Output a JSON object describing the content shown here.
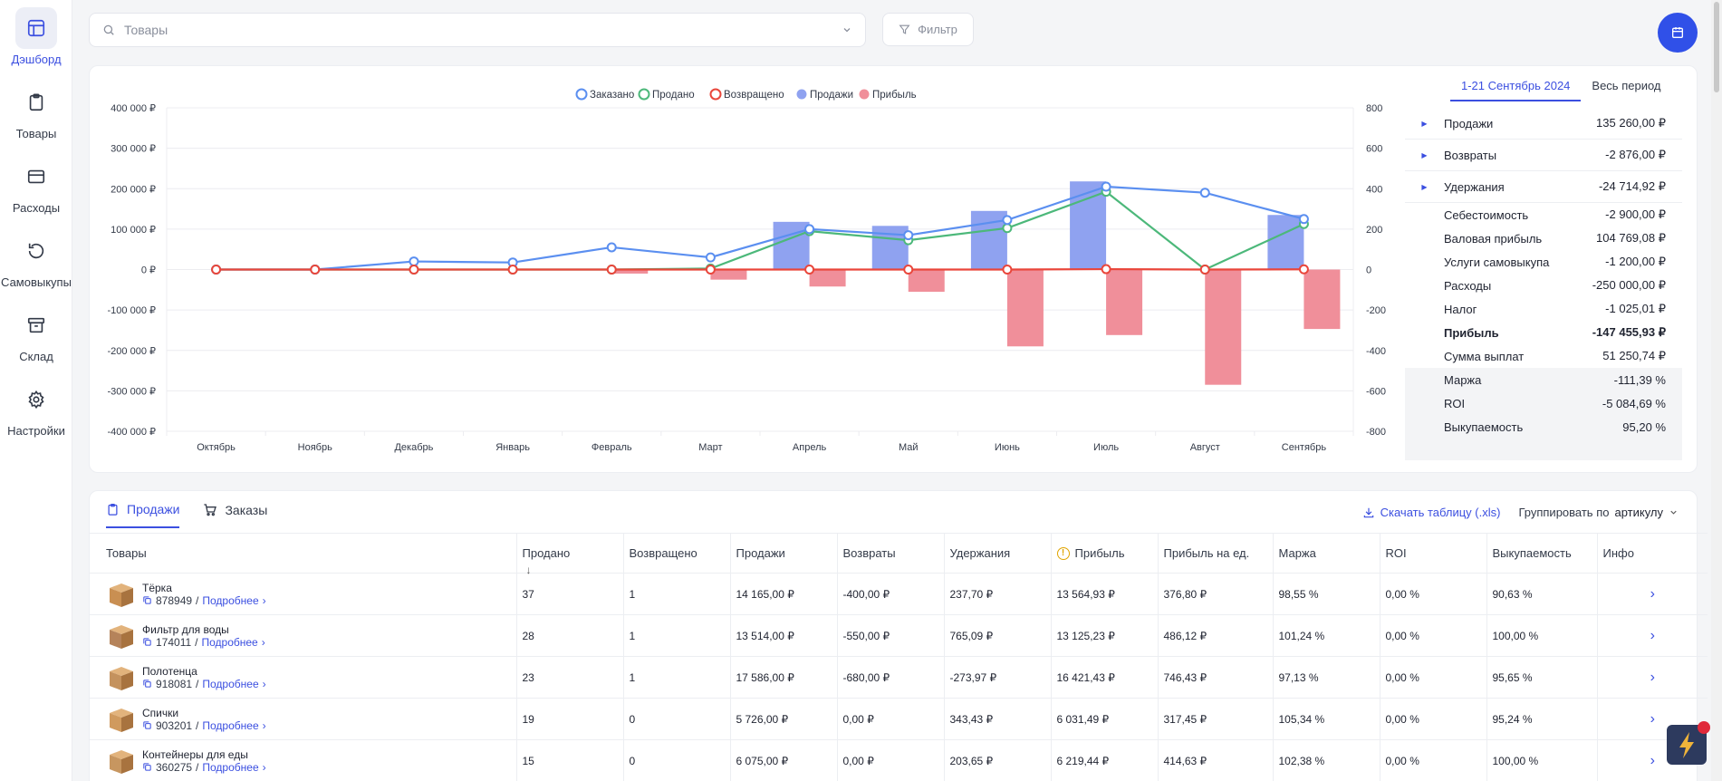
{
  "sidebar": {
    "items": [
      {
        "label": "Дэшборд",
        "icon": "dashboard-icon"
      },
      {
        "label": "Товары",
        "icon": "clipboard-icon"
      },
      {
        "label": "Расходы",
        "icon": "card-icon"
      },
      {
        "label": "Самовыкупы",
        "icon": "refresh-icon"
      },
      {
        "label": "Склад",
        "icon": "archive-icon"
      },
      {
        "label": "Настройки",
        "icon": "gear-icon"
      }
    ]
  },
  "search": {
    "placeholder": "Товары"
  },
  "filter": {
    "label": "Фильтр"
  },
  "colors": {
    "accent": "#3b4fe0",
    "ordered": "#5b8ff0",
    "sold": "#4cb87a",
    "returned": "#e9463b",
    "sales": "#8fa2f0",
    "profit": "#f08f9a"
  },
  "chart_data": {
    "type": "bar",
    "categories": [
      "Октябрь",
      "Ноябрь",
      "Декабрь",
      "Январь",
      "Февраль",
      "Март",
      "Апрель",
      "Май",
      "Июнь",
      "Июль",
      "Август",
      "Сентябрь"
    ],
    "legend": [
      "Заказано",
      "Продано",
      "Возвращено",
      "Продажи",
      "Прибыль"
    ],
    "legend_position": "top-center",
    "left_axis": {
      "ticks": [
        "400 000 ₽",
        "300 000 ₽",
        "200 000 ₽",
        "100 000 ₽",
        "0 ₽",
        "-100 000 ₽",
        "-200 000 ₽",
        "-300 000 ₽",
        "-400 000 ₽"
      ],
      "range": [
        -400000,
        400000
      ]
    },
    "right_axis": {
      "ticks": [
        "800",
        "600",
        "400",
        "200",
        "0",
        "-200",
        "-400",
        "-600",
        "-800"
      ],
      "range": [
        -800,
        800
      ]
    },
    "grid": true,
    "series": [
      {
        "name": "Продажи",
        "axis": "left",
        "kind": "bar",
        "values": [
          0,
          0,
          0,
          0,
          0,
          0,
          118000,
          108000,
          145000,
          218000,
          0,
          135000
        ]
      },
      {
        "name": "Прибыль",
        "axis": "left",
        "kind": "bar",
        "values": [
          0,
          0,
          0,
          0,
          -10000,
          -25000,
          -42000,
          -55000,
          -190000,
          -162000,
          -285000,
          -147000
        ]
      },
      {
        "name": "Заказано",
        "axis": "right",
        "kind": "line",
        "values": [
          0,
          0,
          40,
          35,
          110,
          60,
          200,
          170,
          245,
          410,
          380,
          250
        ]
      },
      {
        "name": "Продано",
        "axis": "right",
        "kind": "line",
        "values": [
          0,
          0,
          0,
          0,
          0,
          5,
          190,
          145,
          205,
          385,
          0,
          225
        ]
      },
      {
        "name": "Возвращено",
        "axis": "right",
        "kind": "line",
        "values": [
          0,
          0,
          0,
          0,
          0,
          0,
          0,
          0,
          0,
          2,
          0,
          1
        ]
      }
    ]
  },
  "period_tabs": [
    "1-21 Сентябрь 2024",
    "Весь период"
  ],
  "summary": [
    {
      "name": "Продажи",
      "value": "135 260,00 ₽",
      "expand": true
    },
    {
      "name": "Возвраты",
      "value": "-2 876,00 ₽",
      "expand": true
    },
    {
      "name": "Удержания",
      "value": "-24 714,92 ₽",
      "expand": true
    },
    {
      "name": "Себестоимость",
      "value": "-2 900,00 ₽"
    },
    {
      "name": "Валовая прибыль",
      "value": "104 769,08 ₽"
    },
    {
      "name": "Услуги самовыкупа",
      "value": "-1 200,00 ₽"
    },
    {
      "name": "Расходы",
      "value": "-250 000,00 ₽"
    },
    {
      "name": "Налог",
      "value": "-1 025,01 ₽"
    },
    {
      "name": "Прибыль",
      "value": "-147 455,93 ₽",
      "bold": true
    },
    {
      "name": "Сумма выплат",
      "value": "51 250,74 ₽"
    },
    {
      "name": "Маржа",
      "value": "-111,39 %",
      "shade": true
    },
    {
      "name": "ROI",
      "value": "-5 084,69 %",
      "shade": true
    },
    {
      "name": "Выкупаемость",
      "value": "95,20 %",
      "shade": true
    }
  ],
  "table": {
    "tabs": [
      "Продажи",
      "Заказы"
    ],
    "download_label": "Скачать таблицу (.xls)",
    "group_prefix": "Группировать по",
    "group_value": "артикулу",
    "headers": [
      "Товары",
      "Продано",
      "Возвращено",
      "Продажи",
      "Возвраты",
      "Удержания",
      "Прибыль",
      "Прибыль на ед.",
      "Маржа",
      "ROI",
      "Выкупаемость",
      "Инфо"
    ],
    "details_label": "Подробнее",
    "rows": [
      {
        "name": "Тёрка",
        "sku": "878949",
        "sold": "37",
        "returned": "1",
        "sales": "14 165,00 ₽",
        "returns": "-400,00 ₽",
        "holds": "237,70 ₽",
        "profit": "13 564,93 ₽",
        "ppu": "376,80 ₽",
        "margin": "98,55 %",
        "roi": "0,00 %",
        "buyout": "90,63 %"
      },
      {
        "name": "Фильтр для воды",
        "sku": "174011",
        "sold": "28",
        "returned": "1",
        "sales": "13 514,00 ₽",
        "returns": "-550,00 ₽",
        "holds": "765,09 ₽",
        "profit": "13 125,23 ₽",
        "ppu": "486,12 ₽",
        "margin": "101,24 %",
        "roi": "0,00 %",
        "buyout": "100,00 %"
      },
      {
        "name": "Полотенца",
        "sku": "918081",
        "sold": "23",
        "returned": "1",
        "sales": "17 586,00 ₽",
        "returns": "-680,00 ₽",
        "holds": "-273,97 ₽",
        "profit": "16 421,43 ₽",
        "ppu": "746,43 ₽",
        "margin": "97,13 %",
        "roi": "0,00 %",
        "buyout": "95,65 %"
      },
      {
        "name": "Спички",
        "sku": "903201",
        "sold": "19",
        "returned": "0",
        "sales": "5 726,00 ₽",
        "returns": "0,00 ₽",
        "holds": "343,43 ₽",
        "profit": "6 031,49 ₽",
        "ppu": "317,45 ₽",
        "margin": "105,34 %",
        "roi": "0,00 %",
        "buyout": "95,24 %"
      },
      {
        "name": "Контейнеры для еды",
        "sku": "360275",
        "sold": "15",
        "returned": "0",
        "sales": "6 075,00 ₽",
        "returns": "0,00 ₽",
        "holds": "203,65 ₽",
        "profit": "6 219,44 ₽",
        "ppu": "414,63 ₽",
        "margin": "102,38 %",
        "roi": "0,00 %",
        "buyout": "100,00 %"
      }
    ]
  }
}
